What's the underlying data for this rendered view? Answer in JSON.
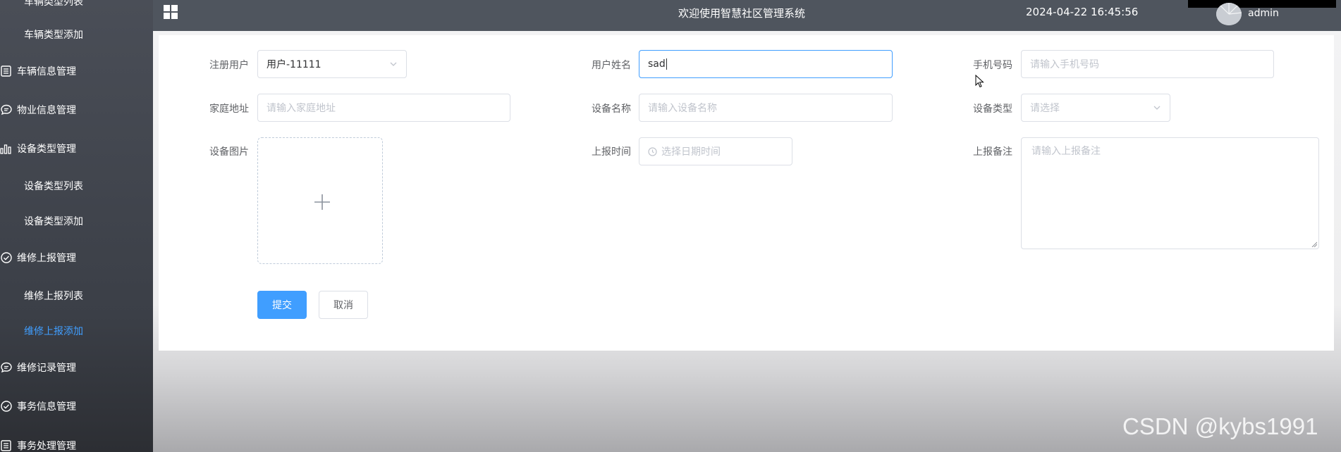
{
  "sidebar": {
    "items": [
      {
        "label": "车辆类型列表",
        "type": "sub",
        "icon": ""
      },
      {
        "label": "车辆类型添加",
        "type": "sub",
        "icon": ""
      },
      {
        "label": "车辆信息管理",
        "type": "main",
        "icon": "list-icon"
      },
      {
        "label": "物业信息管理",
        "type": "main",
        "icon": "chat-icon"
      },
      {
        "label": "设备类型管理",
        "type": "main",
        "icon": "bar-chart-icon"
      },
      {
        "label": "设备类型列表",
        "type": "sub",
        "icon": ""
      },
      {
        "label": "设备类型添加",
        "type": "sub",
        "icon": ""
      },
      {
        "label": "维修上报管理",
        "type": "main",
        "icon": "check-circle-icon"
      },
      {
        "label": "维修上报列表",
        "type": "sub",
        "icon": ""
      },
      {
        "label": "维修上报添加",
        "type": "sub",
        "icon": "",
        "active": true
      },
      {
        "label": "维修记录管理",
        "type": "main",
        "icon": "chat-icon"
      },
      {
        "label": "事务信息管理",
        "type": "main",
        "icon": "check-circle-icon"
      },
      {
        "label": "事务处理管理",
        "type": "main",
        "icon": "list-icon"
      }
    ],
    "active_color": "#409eff"
  },
  "header": {
    "title": "欢迎使用智慧社区管理系统",
    "datetime": "2024-04-22 16:45:56",
    "username": "admin",
    "menu_icon": "grid-icon"
  },
  "form": {
    "registered_user": {
      "label": "注册用户",
      "value": "用户-11111"
    },
    "user_name": {
      "label": "用户姓名",
      "value": "sad"
    },
    "phone": {
      "label": "手机号码",
      "placeholder": "请输入手机号码"
    },
    "address": {
      "label": "家庭地址",
      "placeholder": "请输入家庭地址"
    },
    "device_name": {
      "label": "设备名称",
      "placeholder": "请输入设备名称"
    },
    "device_type": {
      "label": "设备类型",
      "placeholder": "请选择"
    },
    "device_image": {
      "label": "设备图片"
    },
    "report_time": {
      "label": "上报时间",
      "placeholder": "选择日期时间"
    },
    "report_note": {
      "label": "上报备注",
      "placeholder": "请输入上报备注"
    },
    "submit_label": "提交",
    "cancel_label": "取消"
  },
  "watermark": "CSDN @kybs1991",
  "colors": {
    "primary": "#409eff",
    "topbar": "#4f555e"
  }
}
